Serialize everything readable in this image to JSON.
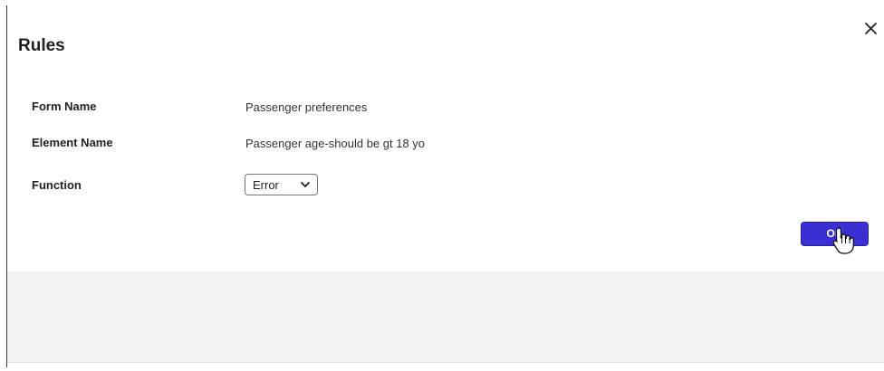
{
  "dialog": {
    "title": "Rules",
    "close_icon": "close-icon",
    "ok_label": "OK"
  },
  "rows": [
    {
      "label": "Form Name",
      "value": "Passenger preferences"
    },
    {
      "label": "Element Name",
      "value": "Passenger age-should be gt 18 yo"
    },
    {
      "label": "Function",
      "value": "Error"
    }
  ],
  "colors": {
    "primary_button": "#3b2fd3",
    "footer_bg": "#f4f4f6"
  }
}
